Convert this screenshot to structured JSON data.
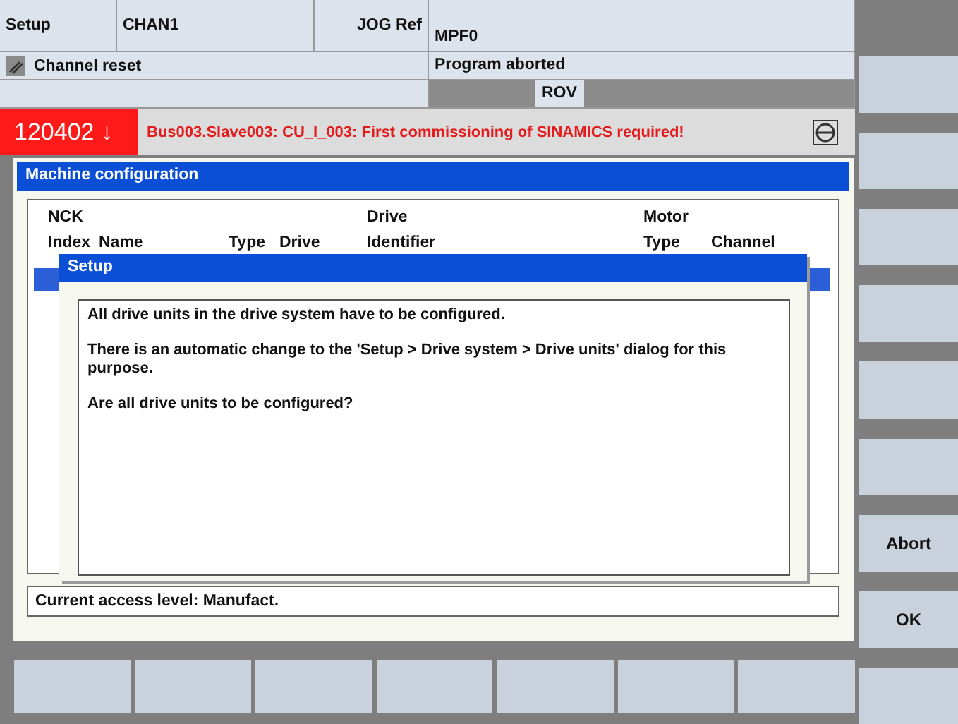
{
  "header": {
    "area": "Setup",
    "channel": "CHAN1",
    "mode": "JOG Ref",
    "program": "MPF0",
    "channel_status": "Channel reset",
    "program_status": "Program aborted",
    "override": "ROV"
  },
  "alarm": {
    "number": "120402",
    "arrow": "↓",
    "message": "Bus003.Slave003: CU_I_003: First commissioning of SINAMICS required!"
  },
  "panel": {
    "title": "Machine configuration",
    "group_headers": [
      "NCK",
      "Drive",
      "Motor"
    ],
    "columns": [
      "Index",
      "Name",
      "Type",
      "Drive",
      "Identifier",
      "Type",
      "Channel"
    ],
    "access_level": "Current access level: Manufact."
  },
  "dialog": {
    "title": "Setup",
    "paragraphs": [
      "All drive units in the drive system have to be configured.",
      "There is an automatic change to the 'Setup > Drive system > Drive units' dialog for this purpose.",
      "Are all drive units to be configured?"
    ]
  },
  "vertical_softkeys": [
    {
      "kind": "blank"
    },
    {
      "kind": "blank"
    },
    {
      "kind": "blank"
    },
    {
      "kind": "blank"
    },
    {
      "kind": "blank"
    },
    {
      "kind": "blank"
    },
    {
      "kind": "labeled",
      "label": "Abort"
    },
    {
      "kind": "labeled",
      "label": "OK"
    },
    {
      "kind": "blank"
    }
  ],
  "horizontal_softkeys": [
    {
      "kind": "blank"
    },
    {
      "kind": "blank"
    },
    {
      "kind": "blank"
    },
    {
      "kind": "blank"
    },
    {
      "kind": "blank"
    },
    {
      "kind": "blank"
    },
    {
      "kind": "blank"
    }
  ]
}
